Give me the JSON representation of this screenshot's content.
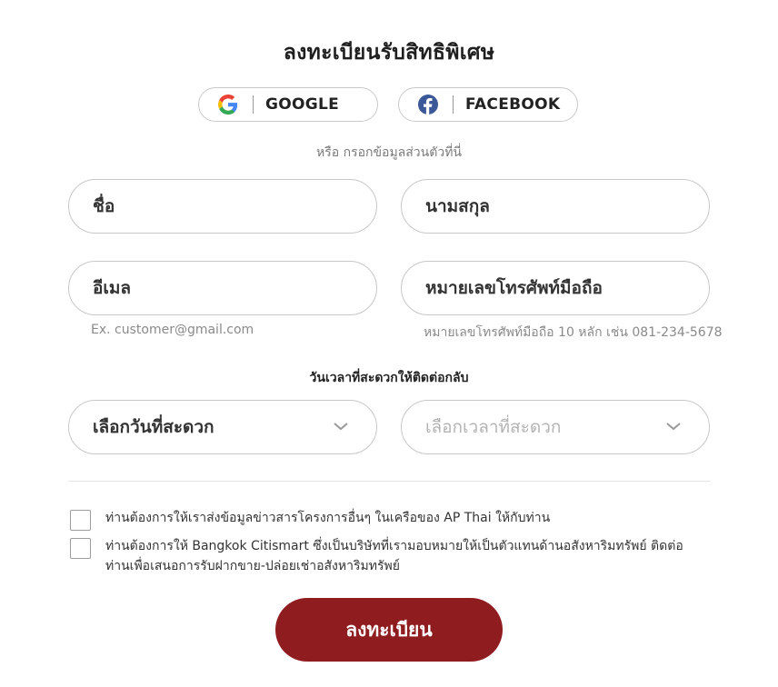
{
  "header": {
    "title": "ลงทะเบียนรับสิทธิพิเศษ"
  },
  "social": {
    "google_label": "GOOGLE",
    "facebook_label": "FACEBOOK",
    "or_text": "หรือ กรอกข้อมูลส่วนตัวที่นี่"
  },
  "form": {
    "first_name": "ชื่อ",
    "last_name": "นามสกุล",
    "email": "อีเมล",
    "email_hint": "Ex. customer@gmail.com",
    "phone": "หมายเลขโทรศัพท์มือถือ",
    "phone_hint": "หมายเลขโทรศัพท์มือถือ 10 หลัก เช่น 081-234-5678",
    "contact_time_label": "วันเวลาที่สะดวกให้ติดต่อกลับ",
    "date_select": "เลือกวันที่สะดวก",
    "time_select": "เลือกเวลาที่สะดวก"
  },
  "consent": {
    "item1": "ท่านต้องการให้เราส่งข้อมูลข่าวสารโครงการอื่นๆ ในเครือของ AP Thai ให้กับท่าน",
    "item2_line1": "ท่านต้องการให้ Bangkok Citismart ซึ่งเป็นบริษัทที่เรามอบหมายให้เป็นตัวแทนด้านอสังหาริมทรัพย์ ติดต่อ",
    "item2_line2": "ท่านเพื่อเสนอการรับฝากขาย-ปล่อยเช่าอสังหาริมทรัพย์"
  },
  "submit_label": "ลงทะเบียน",
  "icons": {
    "google": "google-icon",
    "facebook": "facebook-icon",
    "chevron": "chevron-down-icon"
  },
  "colors": {
    "accent": "#8f1c1f",
    "facebook_blue": "#3b5998"
  }
}
